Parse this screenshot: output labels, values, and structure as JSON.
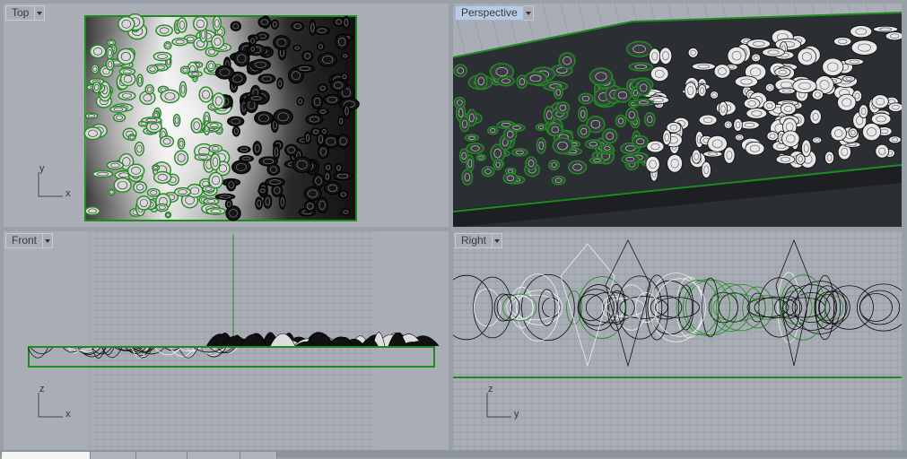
{
  "viewports": {
    "top": {
      "label": "Top",
      "axes": [
        "y",
        "x"
      ]
    },
    "perspective": {
      "label": "Perspective"
    },
    "front": {
      "label": "Front",
      "axes": [
        "z",
        "x"
      ]
    },
    "right": {
      "label": "Right",
      "axes": [
        "z",
        "y"
      ]
    }
  },
  "colors": {
    "viewport_bg": "#a9aeb6",
    "selection_green": "#1f8a1f",
    "active_label": "#b8cbe2"
  },
  "icons": {
    "viewport_menu": "chevron-down-icon"
  }
}
